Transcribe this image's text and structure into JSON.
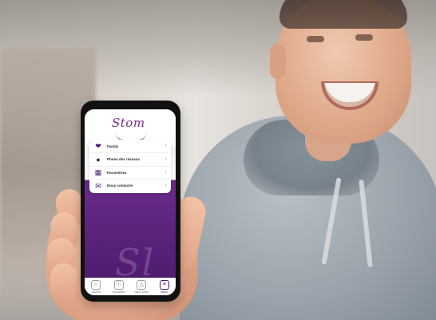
{
  "app": {
    "logo_text": "Stom"
  },
  "menu": {
    "items": [
      {
        "icon": "heart-icon",
        "glyph": "❤",
        "label": "Family"
      },
      {
        "icon": "pin-icon",
        "glyph": "●",
        "label": "Phone des réseaux"
      },
      {
        "icon": "grid-icon",
        "glyph": "▦",
        "label": "Paramètres"
      },
      {
        "icon": "envelope-icon",
        "glyph": "✉",
        "label": "Nous contacter"
      }
    ]
  },
  "bottom_nav": {
    "items": [
      {
        "icon": "home-icon",
        "glyph": "⌂",
        "label": "Accueil",
        "active": false
      },
      {
        "icon": "info-icon",
        "glyph": "ⓘ",
        "label": "Nouvelles",
        "active": false
      },
      {
        "icon": "alert-icon",
        "glyph": "△",
        "label": "Nous aider",
        "active": false
      },
      {
        "icon": "menu-icon",
        "glyph": "≡",
        "label": "Menu",
        "active": true
      }
    ]
  },
  "colors": {
    "brand_purple": "#6a2a8c",
    "brand_dark": "#4a1a6a"
  }
}
